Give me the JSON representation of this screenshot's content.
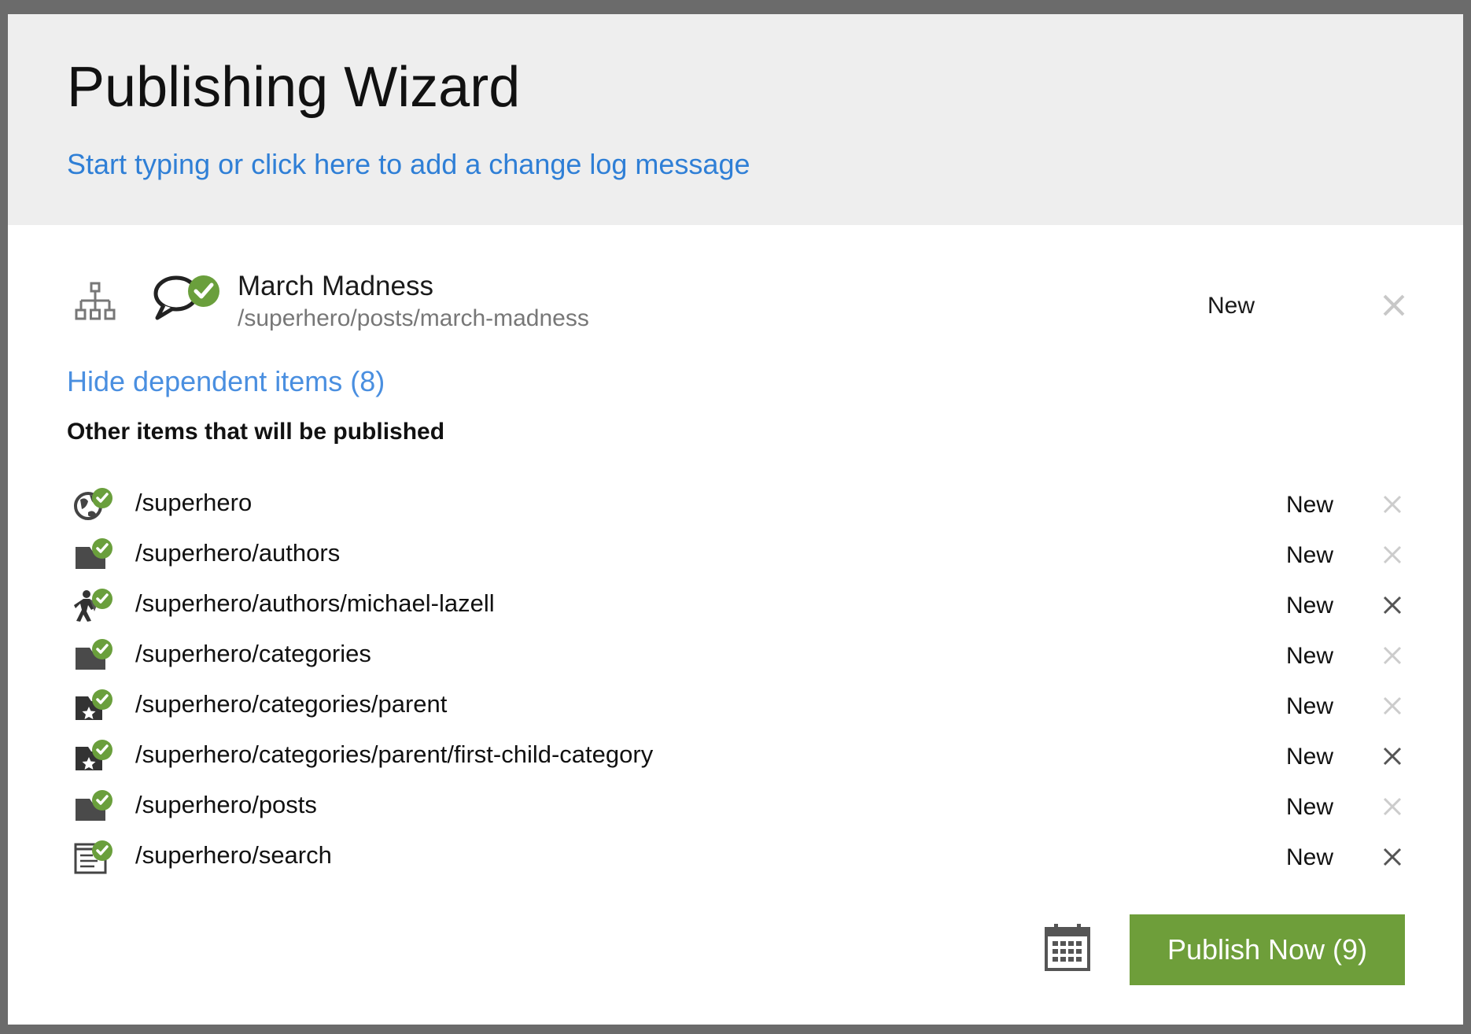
{
  "wizard": {
    "title": "Publishing Wizard",
    "changelog_placeholder": "Start typing or click here to add a change log message"
  },
  "main_item": {
    "title": "March Madness",
    "path": "/superhero/posts/march-madness",
    "status": "New",
    "icons": [
      "sitemap-icon",
      "comment-icon",
      "checkmark-badge-icon"
    ]
  },
  "dependents": {
    "toggle_label": "Hide dependent items (8)",
    "heading": "Other items that will be published",
    "items": [
      {
        "path": "/superhero",
        "status": "New",
        "icon": "globe-icon",
        "remove_enabled": false
      },
      {
        "path": "/superhero/authors",
        "status": "New",
        "icon": "folder-icon",
        "remove_enabled": false
      },
      {
        "path": "/superhero/authors/michael-lazell",
        "status": "New",
        "icon": "superhero-author-icon",
        "remove_enabled": true
      },
      {
        "path": "/superhero/categories",
        "status": "New",
        "icon": "folder-icon",
        "remove_enabled": false
      },
      {
        "path": "/superhero/categories/parent",
        "status": "New",
        "icon": "star-folder-icon",
        "remove_enabled": false
      },
      {
        "path": "/superhero/categories/parent/first-child-category",
        "status": "New",
        "icon": "star-folder-icon",
        "remove_enabled": true
      },
      {
        "path": "/superhero/posts",
        "status": "New",
        "icon": "folder-icon",
        "remove_enabled": false
      },
      {
        "path": "/superhero/search",
        "status": "New",
        "icon": "search-page-icon",
        "remove_enabled": true
      }
    ]
  },
  "actions": {
    "publish_label": "Publish Now (9)",
    "schedule_icon": "calendar-icon"
  },
  "colors": {
    "link": "#2f7fd6",
    "publish_button": "#6e9e3a",
    "check_badge": "#6a9f3c",
    "remove_enabled": "#555555",
    "remove_disabled": "#cccccc"
  }
}
